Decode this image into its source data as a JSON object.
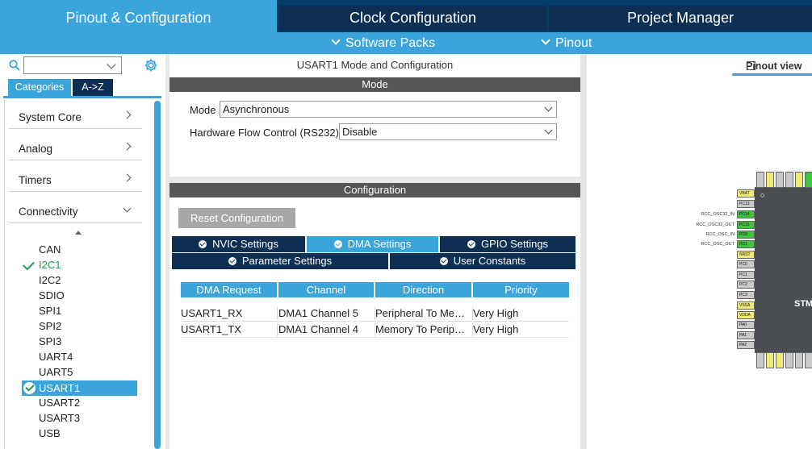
{
  "top_tabs": {
    "pinout": "Pinout & Configuration",
    "clock": "Clock Configuration",
    "project": "Project Manager"
  },
  "subbar": {
    "software_packs": "Software Packs",
    "pinout": "Pinout"
  },
  "left": {
    "search_value": "",
    "tab_categories": "Categories",
    "tab_az": "A->Z",
    "categories": [
      "System Core",
      "Analog",
      "Timers",
      "Connectivity"
    ],
    "peripherals": [
      "CAN",
      "I2C1",
      "I2C2",
      "SDIO",
      "SPI1",
      "SPI2",
      "SPI3",
      "UART4",
      "UART5",
      "USART1",
      "USART2",
      "USART3",
      "USB"
    ]
  },
  "mid": {
    "title": "USART1 Mode and Configuration",
    "mode_header": "Mode",
    "mode_label": "Mode",
    "mode_value": "Asynchronous",
    "hwflow_label": "Hardware Flow Control (RS232)",
    "hwflow_value": "Disable",
    "config_header": "Configuration",
    "reset_button": "Reset Configuration",
    "tabs": {
      "nvic": "NVIC Settings",
      "dma": "DMA Settings",
      "gpio": "GPIO Settings",
      "param": "Parameter Settings",
      "user": "User Constants"
    },
    "table": {
      "headers": [
        "DMA Request",
        "Channel",
        "Direction",
        "Priority"
      ],
      "rows": [
        [
          "USART1_RX",
          "DMA1 Channel 5",
          "Peripheral To Memory",
          "Very High"
        ],
        [
          "USART1_TX",
          "DMA1 Channel 4",
          "Memory To Peripheral",
          "Very High"
        ]
      ]
    }
  },
  "right": {
    "pinout_view": "Pinout view",
    "chip_text": "STM",
    "left_pins": [
      "VBAT",
      "PC13",
      "PC14",
      "PC15",
      "PD0",
      "PD1",
      "NRST",
      "PC0",
      "PC1",
      "PC2",
      "PC3",
      "VSSA",
      "VDDA",
      "PA0",
      "PA1",
      "PA2"
    ],
    "signal_labels": [
      "RCC_OSC32_IN",
      "RCC_OSC32_OUT",
      "RCC_OSC_IN",
      "RCC_OSC_OUT"
    ]
  },
  "colors": {
    "accent": "#3ba4da",
    "dark": "#0d2f54",
    "check_green": "#1d9a4a",
    "pin_green": "#3fc43f",
    "pin_yellow": "#f1ea76"
  }
}
